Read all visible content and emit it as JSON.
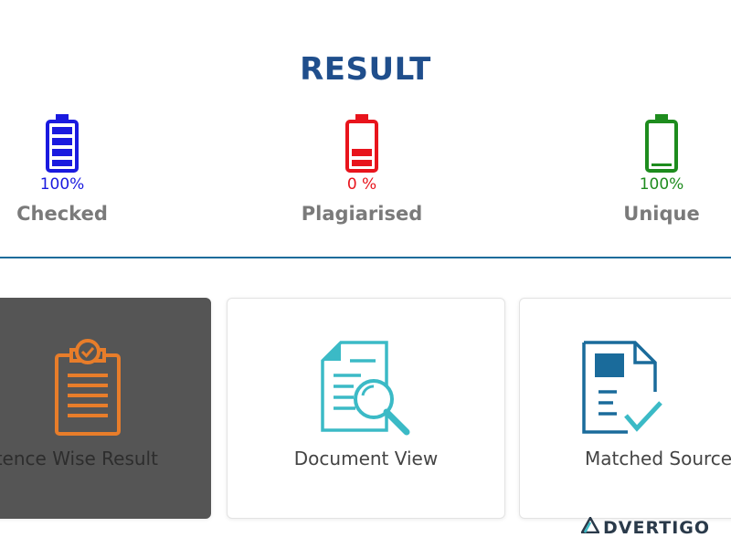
{
  "header": {
    "title": "RESULT"
  },
  "stats": [
    {
      "percent_text": "100%",
      "label": "Checked",
      "color": "#1a1adf",
      "level": 1.0
    },
    {
      "percent_text": "0 %",
      "label": "Plagiarised",
      "color": "#e8141c",
      "level": 0.0
    },
    {
      "percent_text": "100%",
      "label": "Unique",
      "color": "#1e8c1e",
      "level": 1.0
    }
  ],
  "cards": [
    {
      "label": "ntence Wise Result",
      "accent": "#e87d2a"
    },
    {
      "label": "Document View",
      "accent": "#3bbac6"
    },
    {
      "label": "Matched Source",
      "accent": "#1a6b9b"
    }
  ],
  "watermark": {
    "text": "DVERTIGO"
  }
}
